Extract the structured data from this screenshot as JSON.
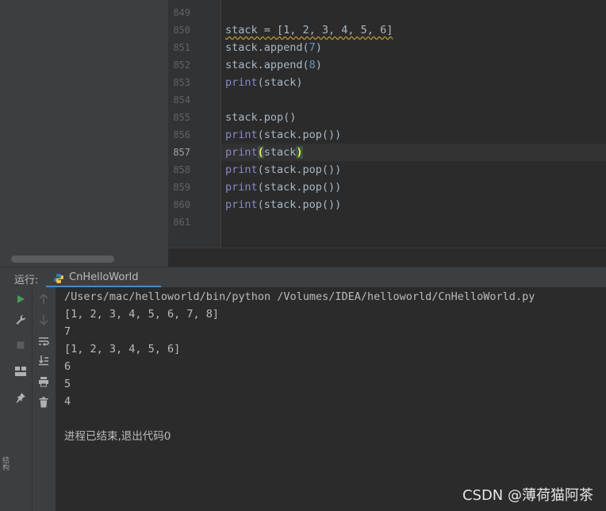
{
  "side_label": "结构",
  "editor": {
    "line_numbers": [
      "849",
      "850",
      "851",
      "852",
      "853",
      "854",
      "855",
      "856",
      "857",
      "858",
      "859",
      "860",
      "861"
    ],
    "current_line": "857",
    "code": {
      "l850_a": "stack = [1, 2, 3, 4, 5, 6]",
      "l851": [
        "stack.append(",
        "7",
        ")"
      ],
      "l852": [
        "stack.append(",
        "8",
        ")"
      ],
      "l853": [
        "print",
        "(stack)"
      ],
      "l855": "stack.pop()",
      "l856": [
        "print",
        "(stack.pop())"
      ],
      "l857": [
        "print",
        "(",
        "stack",
        ")"
      ],
      "l858": [
        "print",
        "(stack.pop())"
      ],
      "l859": [
        "print",
        "(stack.pop())"
      ],
      "l860": [
        "print",
        "(stack.pop())"
      ]
    }
  },
  "run": {
    "title": "运行:",
    "tab_label": "CnHelloWorld",
    "output": [
      "/Users/mac/helloworld/bin/python /Volumes/IDEA/helloworld/CnHelloWorld.py",
      "[1, 2, 3, 4, 5, 6, 7, 8]",
      "7",
      "[1, 2, 3, 4, 5, 6]",
      "6",
      "5",
      "4",
      "",
      "进程已结束,退出代码0"
    ],
    "toolbar_icons": [
      "run-icon",
      "wrench-icon",
      "stop-icon",
      "layout-icon",
      "pin-icon"
    ],
    "toolbar2_icons": [
      "up-arrow-icon",
      "down-arrow-icon",
      "soft-wrap-icon",
      "scroll-to-end-icon",
      "print-icon",
      "trash-icon"
    ]
  },
  "watermark": "CSDN @薄荷猫阿茶",
  "colors": {
    "accent": "#4a88c7",
    "run_green": "#499c54"
  }
}
